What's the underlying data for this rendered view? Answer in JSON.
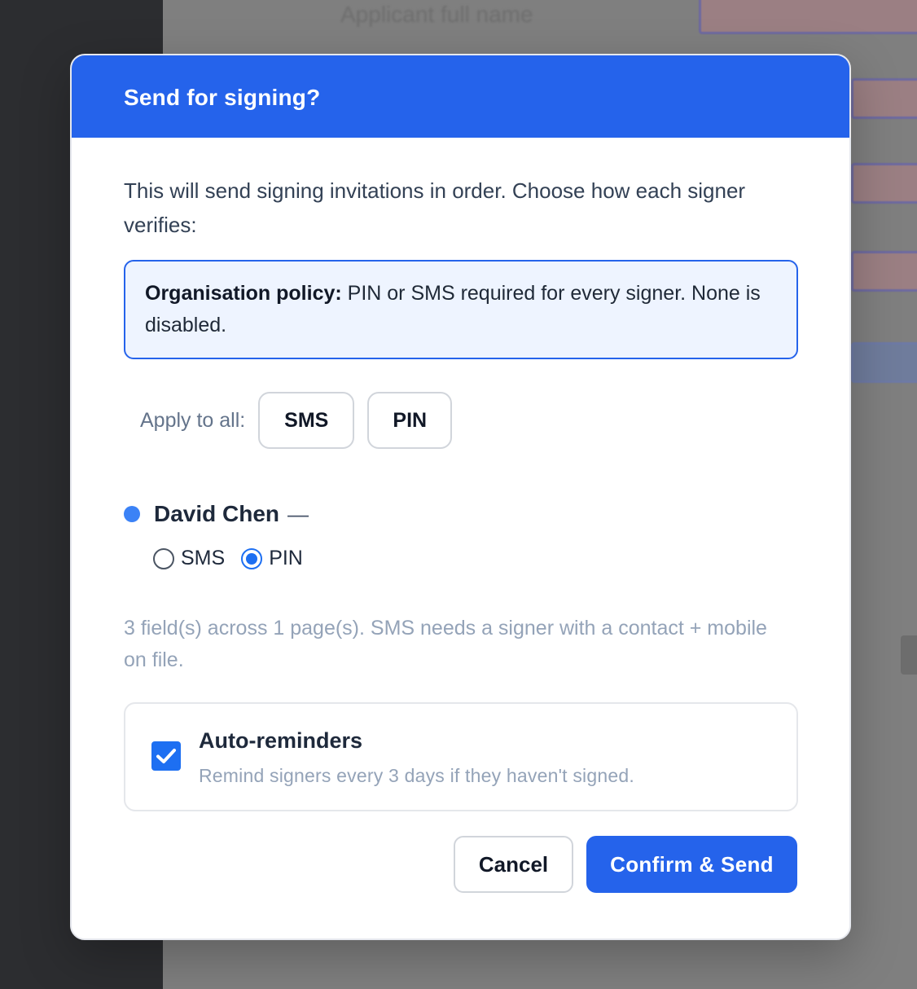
{
  "backdrop": {
    "header_text": "Applicant full name"
  },
  "modal": {
    "title": "Send for signing?",
    "intro": "This will send signing invitations in order. Choose how each signer verifies:",
    "policy": {
      "label": "Organisation policy:",
      "text": " PIN or SMS required for every signer. None is disabled."
    },
    "apply_all": {
      "label": "Apply to all:",
      "options": [
        "SMS",
        "PIN"
      ]
    },
    "signer": {
      "name": "David Chen",
      "dash": "—",
      "methods": [
        {
          "label": "SMS",
          "selected": false
        },
        {
          "label": "PIN",
          "selected": true
        }
      ]
    },
    "hint": "3 field(s) across 1 page(s). SMS needs a signer with a contact + mobile on file.",
    "reminders": {
      "checked": true,
      "title": "Auto-reminders",
      "description": "Remind signers every 3 days if they haven't signed."
    },
    "actions": {
      "cancel": "Cancel",
      "confirm": "Confirm & Send"
    }
  },
  "colors": {
    "accent": "#2563eb",
    "policy_bg": "#eef4ff",
    "signer_dot": "#3b82f6"
  },
  "icons": {
    "check": "check-icon",
    "signer_status": "dot-icon"
  }
}
